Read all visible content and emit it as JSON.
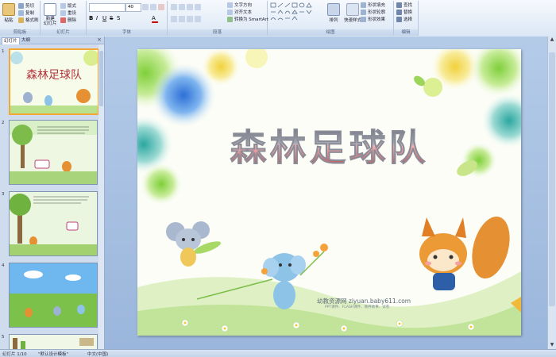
{
  "ribbon": {
    "groups": {
      "clipboard": "剪贴板",
      "slides": "幻灯片",
      "font": "字体",
      "paragraph": "段落",
      "drawing": "绘图",
      "editing": "编辑"
    },
    "clipboard": {
      "paste": "粘贴",
      "cut": "剪切",
      "copy": "复制",
      "format_painter": "格式刷"
    },
    "slides": {
      "new_slide": "新建\n幻灯片",
      "layout": "版式",
      "reset": "重设",
      "delete": "删除"
    },
    "font": {
      "size": "40"
    },
    "paragraph": {
      "text_direction": "文字方向",
      "align_text": "对齐文本",
      "smartart": "转换为 SmartArt"
    },
    "drawing": {
      "arrange": "排列",
      "quick_styles": "快速样式",
      "shape_fill": "形状填充",
      "shape_outline": "形状轮廓",
      "shape_effects": "形状效果"
    },
    "editing": {
      "find": "查找",
      "replace": "替换",
      "select": "选择"
    }
  },
  "left_pane": {
    "tab_slides": "幻灯片",
    "tab_outline": "大纲",
    "close": "×",
    "slide_numbers": [
      "1",
      "2",
      "3",
      "4",
      "5"
    ]
  },
  "slide": {
    "title": "森林足球队",
    "watermark": "幼教资源网 ziyuan.baby611.com",
    "watermark_sub": "PPT课件、FLASH课件、教养故事、试卷"
  },
  "statusbar": {
    "slide_counter": "幻灯片 1/10",
    "theme": "\"默认设计模板\"",
    "language": "中文(中国)"
  },
  "colors": {
    "title_red": "#b2333b",
    "thumb_selected": "#f4a637",
    "ribbon_bg": "#dbe7f5"
  }
}
